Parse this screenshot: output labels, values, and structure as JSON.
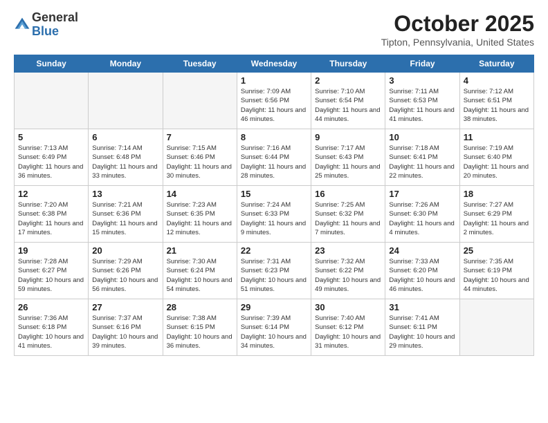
{
  "logo": {
    "general": "General",
    "blue": "Blue"
  },
  "title": "October 2025",
  "location": "Tipton, Pennsylvania, United States",
  "days_of_week": [
    "Sunday",
    "Monday",
    "Tuesday",
    "Wednesday",
    "Thursday",
    "Friday",
    "Saturday"
  ],
  "weeks": [
    [
      {
        "day": "",
        "info": "",
        "empty": true
      },
      {
        "day": "",
        "info": "",
        "empty": true
      },
      {
        "day": "",
        "info": "",
        "empty": true
      },
      {
        "day": "1",
        "info": "Sunrise: 7:09 AM\nSunset: 6:56 PM\nDaylight: 11 hours and 46 minutes.",
        "empty": false
      },
      {
        "day": "2",
        "info": "Sunrise: 7:10 AM\nSunset: 6:54 PM\nDaylight: 11 hours and 44 minutes.",
        "empty": false
      },
      {
        "day": "3",
        "info": "Sunrise: 7:11 AM\nSunset: 6:53 PM\nDaylight: 11 hours and 41 minutes.",
        "empty": false
      },
      {
        "day": "4",
        "info": "Sunrise: 7:12 AM\nSunset: 6:51 PM\nDaylight: 11 hours and 38 minutes.",
        "empty": false
      }
    ],
    [
      {
        "day": "5",
        "info": "Sunrise: 7:13 AM\nSunset: 6:49 PM\nDaylight: 11 hours and 36 minutes.",
        "empty": false
      },
      {
        "day": "6",
        "info": "Sunrise: 7:14 AM\nSunset: 6:48 PM\nDaylight: 11 hours and 33 minutes.",
        "empty": false
      },
      {
        "day": "7",
        "info": "Sunrise: 7:15 AM\nSunset: 6:46 PM\nDaylight: 11 hours and 30 minutes.",
        "empty": false
      },
      {
        "day": "8",
        "info": "Sunrise: 7:16 AM\nSunset: 6:44 PM\nDaylight: 11 hours and 28 minutes.",
        "empty": false
      },
      {
        "day": "9",
        "info": "Sunrise: 7:17 AM\nSunset: 6:43 PM\nDaylight: 11 hours and 25 minutes.",
        "empty": false
      },
      {
        "day": "10",
        "info": "Sunrise: 7:18 AM\nSunset: 6:41 PM\nDaylight: 11 hours and 22 minutes.",
        "empty": false
      },
      {
        "day": "11",
        "info": "Sunrise: 7:19 AM\nSunset: 6:40 PM\nDaylight: 11 hours and 20 minutes.",
        "empty": false
      }
    ],
    [
      {
        "day": "12",
        "info": "Sunrise: 7:20 AM\nSunset: 6:38 PM\nDaylight: 11 hours and 17 minutes.",
        "empty": false
      },
      {
        "day": "13",
        "info": "Sunrise: 7:21 AM\nSunset: 6:36 PM\nDaylight: 11 hours and 15 minutes.",
        "empty": false
      },
      {
        "day": "14",
        "info": "Sunrise: 7:23 AM\nSunset: 6:35 PM\nDaylight: 11 hours and 12 minutes.",
        "empty": false
      },
      {
        "day": "15",
        "info": "Sunrise: 7:24 AM\nSunset: 6:33 PM\nDaylight: 11 hours and 9 minutes.",
        "empty": false
      },
      {
        "day": "16",
        "info": "Sunrise: 7:25 AM\nSunset: 6:32 PM\nDaylight: 11 hours and 7 minutes.",
        "empty": false
      },
      {
        "day": "17",
        "info": "Sunrise: 7:26 AM\nSunset: 6:30 PM\nDaylight: 11 hours and 4 minutes.",
        "empty": false
      },
      {
        "day": "18",
        "info": "Sunrise: 7:27 AM\nSunset: 6:29 PM\nDaylight: 11 hours and 2 minutes.",
        "empty": false
      }
    ],
    [
      {
        "day": "19",
        "info": "Sunrise: 7:28 AM\nSunset: 6:27 PM\nDaylight: 10 hours and 59 minutes.",
        "empty": false
      },
      {
        "day": "20",
        "info": "Sunrise: 7:29 AM\nSunset: 6:26 PM\nDaylight: 10 hours and 56 minutes.",
        "empty": false
      },
      {
        "day": "21",
        "info": "Sunrise: 7:30 AM\nSunset: 6:24 PM\nDaylight: 10 hours and 54 minutes.",
        "empty": false
      },
      {
        "day": "22",
        "info": "Sunrise: 7:31 AM\nSunset: 6:23 PM\nDaylight: 10 hours and 51 minutes.",
        "empty": false
      },
      {
        "day": "23",
        "info": "Sunrise: 7:32 AM\nSunset: 6:22 PM\nDaylight: 10 hours and 49 minutes.",
        "empty": false
      },
      {
        "day": "24",
        "info": "Sunrise: 7:33 AM\nSunset: 6:20 PM\nDaylight: 10 hours and 46 minutes.",
        "empty": false
      },
      {
        "day": "25",
        "info": "Sunrise: 7:35 AM\nSunset: 6:19 PM\nDaylight: 10 hours and 44 minutes.",
        "empty": false
      }
    ],
    [
      {
        "day": "26",
        "info": "Sunrise: 7:36 AM\nSunset: 6:18 PM\nDaylight: 10 hours and 41 minutes.",
        "empty": false
      },
      {
        "day": "27",
        "info": "Sunrise: 7:37 AM\nSunset: 6:16 PM\nDaylight: 10 hours and 39 minutes.",
        "empty": false
      },
      {
        "day": "28",
        "info": "Sunrise: 7:38 AM\nSunset: 6:15 PM\nDaylight: 10 hours and 36 minutes.",
        "empty": false
      },
      {
        "day": "29",
        "info": "Sunrise: 7:39 AM\nSunset: 6:14 PM\nDaylight: 10 hours and 34 minutes.",
        "empty": false
      },
      {
        "day": "30",
        "info": "Sunrise: 7:40 AM\nSunset: 6:12 PM\nDaylight: 10 hours and 31 minutes.",
        "empty": false
      },
      {
        "day": "31",
        "info": "Sunrise: 7:41 AM\nSunset: 6:11 PM\nDaylight: 10 hours and 29 minutes.",
        "empty": false
      },
      {
        "day": "",
        "info": "",
        "empty": true
      }
    ]
  ]
}
